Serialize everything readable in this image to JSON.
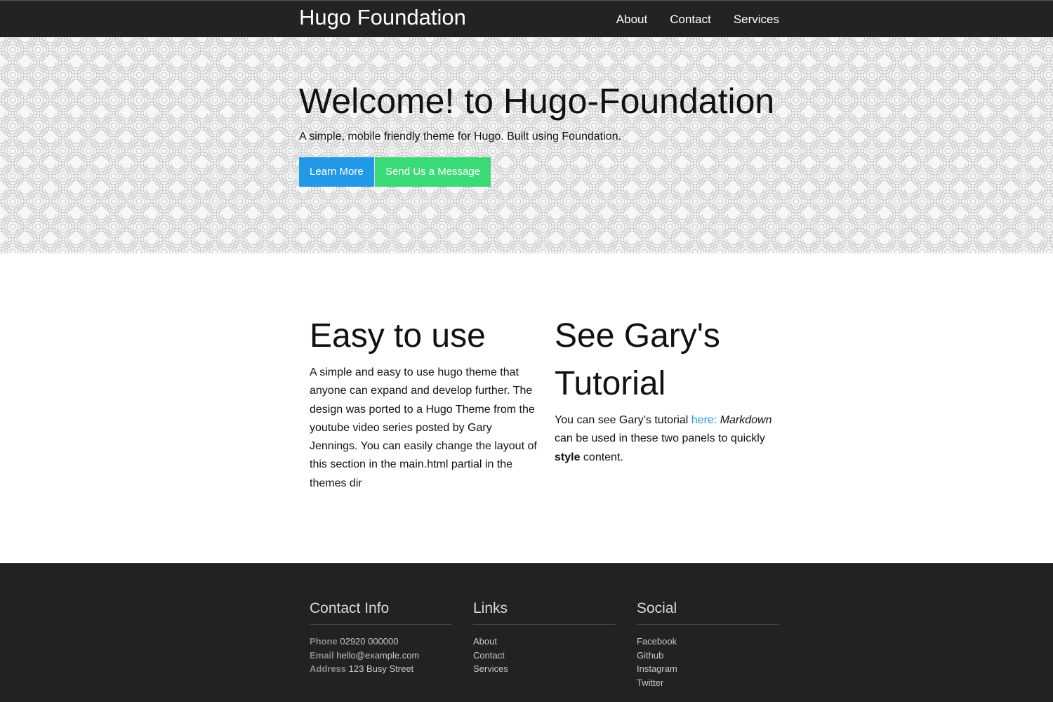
{
  "nav": {
    "brand": "Hugo Foundation",
    "links": [
      "About",
      "Contact",
      "Services"
    ]
  },
  "hero": {
    "title": "Welcome! to Hugo-Foundation",
    "subtitle": "A simple, mobile friendly theme for Hugo. Built using Foundation.",
    "primary_button": "Learn More",
    "secondary_button": "Send Us a Message"
  },
  "panels": {
    "left": {
      "title": "Easy to use",
      "body": "A simple and easy to use hugo theme that anyone can expand and develop further. The design was ported to a Hugo Theme from the youtube video series posted by Gary Jennings. You can easily change the layout of this section in the main.html partial in the themes dir"
    },
    "right": {
      "title": "See Gary's Tutorial",
      "text_before_link": "You can see Gary’s tutorial ",
      "link_text": "here:",
      "emphasis": "Markdown",
      "text_middle": " can be used in these two panels to quickly ",
      "strong": "style",
      "text_after": " content."
    }
  },
  "footer": {
    "contact": {
      "title": "Contact Info",
      "phone_label": "Phone",
      "phone": "02920 000000",
      "email_label": "Email",
      "email": "hello@example.com",
      "address_label": "Address",
      "address": "123 Busy Street"
    },
    "links": {
      "title": "Links",
      "items": [
        "About",
        "Contact",
        "Services"
      ]
    },
    "social": {
      "title": "Social",
      "items": [
        "Facebook",
        "Github",
        "Instagram",
        "Twitter"
      ]
    }
  },
  "colors": {
    "nav_bg": "#232323",
    "primary": "#2199e8",
    "success": "#3adb76",
    "footer_bg": "#222222"
  }
}
